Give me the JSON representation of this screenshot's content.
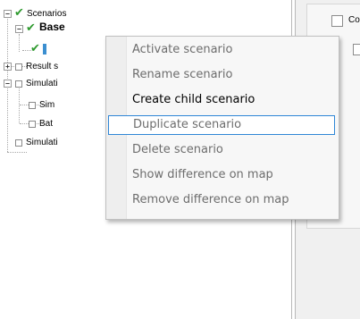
{
  "tree": {
    "nodes": [
      {
        "label": "Scenarios",
        "check": "✔",
        "expander": "−"
      },
      {
        "label": "Base",
        "check": "✔",
        "expander": "−"
      },
      {
        "label": "Result s",
        "expander": "+"
      },
      {
        "label": "Simulati",
        "expander": "−"
      },
      {
        "label": "Sim"
      },
      {
        "label": "Bat"
      },
      {
        "label": "Simulati"
      }
    ]
  },
  "right_panel": {
    "checkbox_label": "Co"
  },
  "context_menu": {
    "items": [
      {
        "label": "Activate scenario",
        "enabled": false
      },
      {
        "label": "Rename scenario",
        "enabled": false
      },
      {
        "label": "Create child scenario",
        "enabled": true
      },
      {
        "label": "Duplicate scenario",
        "enabled": false,
        "highlighted": true
      },
      {
        "label": "Delete scenario",
        "enabled": false
      },
      {
        "label": "Show difference on map",
        "enabled": false
      },
      {
        "label": "Remove difference on map",
        "enabled": false
      }
    ]
  }
}
